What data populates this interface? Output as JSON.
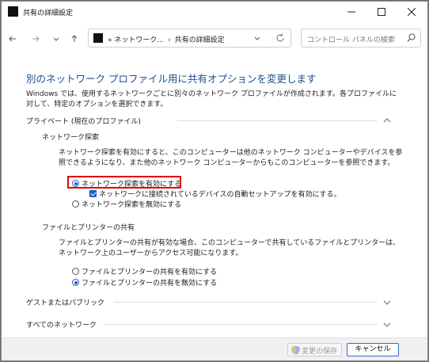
{
  "window": {
    "title": "共有の詳細設定"
  },
  "nav": {
    "breadcrumb_prefix": "«",
    "breadcrumb_parent": "ネットワーク...",
    "breadcrumb_sep": "›",
    "breadcrumb_current": "共有の詳細設定",
    "search_placeholder": "コントロール パネルの検索"
  },
  "main": {
    "heading": "別のネットワーク プロファイル用に共有オプションを変更します",
    "intro": "Windows では、使用するネットワークごとに別々のネットワーク プロファイルが作成されます。各プロファイルに対して、特定のオプションを選択できます。",
    "private": {
      "label": "プライベート (現在のプロファイル)",
      "discovery": {
        "title": "ネットワーク探索",
        "description": "ネットワーク探索を有効にすると、このコンピューターは他のネットワーク コンピューターやデバイスを参照できるようになり、また他のネットワーク コンピューターからもこのコンピューターを参照できます。",
        "on_label": "ネットワーク探索を有効にする",
        "auto_setup_label": "ネットワークに接続されているデバイスの自動セットアップを有効にする。",
        "off_label": "ネットワーク探索を無効にする"
      },
      "sharing": {
        "title": "ファイルとプリンターの共有",
        "description": "ファイルとプリンターの共有が有効な場合、このコンピューターで共有しているファイルとプリンターは、ネットワーク上のユーザーからアクセス可能になります。",
        "on_label": "ファイルとプリンターの共有を有効にする",
        "off_label": "ファイルとプリンターの共有を無効にする"
      }
    },
    "guest_label": "ゲストまたはパブリック",
    "all_label": "すべてのネットワーク"
  },
  "footer": {
    "save_label": "変更の保存",
    "cancel_label": "キャンセル"
  },
  "state": {
    "discovery_selected": "on",
    "auto_setup_checked": true,
    "sharing_selected": "off"
  },
  "colors": {
    "heading": "#1e4e8c",
    "accent": "#1f5fbf",
    "highlight": "#e00000"
  }
}
